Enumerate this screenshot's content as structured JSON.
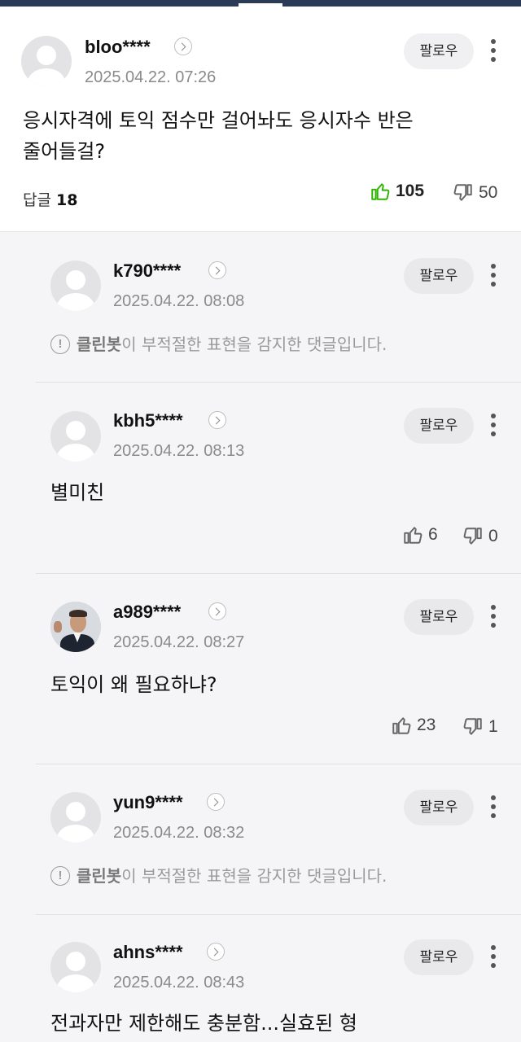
{
  "main_comment": {
    "username": "bloo****",
    "timestamp": "2025.04.22. 07:26",
    "follow_label": "팔로우",
    "text_line1": "응시자격에 토익 점수만 걸어놔도 응시자수 반은",
    "text_line2": "줄어들걸?",
    "reply_label": "답글",
    "reply_count": "18",
    "likes": "105",
    "dislikes": "50",
    "like_color": "#2db400"
  },
  "replies": [
    {
      "username": "k790****",
      "timestamp": "2025.04.22. 08:08",
      "follow_label": "팔로우",
      "cleanbot_name": "클린봇",
      "cleanbot_text": "이 부적절한 표현을 감지한 댓글입니다."
    },
    {
      "username": "kbh5****",
      "timestamp": "2025.04.22. 08:13",
      "follow_label": "팔로우",
      "text": "별미친",
      "likes": "6",
      "dislikes": "0"
    },
    {
      "username": "a989****",
      "timestamp": "2025.04.22. 08:27",
      "follow_label": "팔로우",
      "text": "토익이 왜 필요하냐?",
      "likes": "23",
      "dislikes": "1"
    },
    {
      "username": "yun9****",
      "timestamp": "2025.04.22. 08:32",
      "follow_label": "팔로우",
      "cleanbot_name": "클린봇",
      "cleanbot_text": "이 부적절한 표현을 감지한 댓글입니다."
    },
    {
      "username": "ahns****",
      "timestamp": "2025.04.22. 08:43",
      "follow_label": "팔로우",
      "text": "전과자만 제한해도 충분함...실효된 형"
    }
  ],
  "icons": {
    "avatar_default": "default-avatar-icon",
    "profile_chevron": "chevron-right-icon",
    "more": "more-vertical-icon",
    "like": "thumbs-up-icon",
    "dislike": "thumbs-down-icon",
    "info": "info-circle-icon"
  },
  "colors": {
    "header_bar": "#2b3a55",
    "reply_background": "#f5f5f7",
    "like_active": "#2db400"
  }
}
